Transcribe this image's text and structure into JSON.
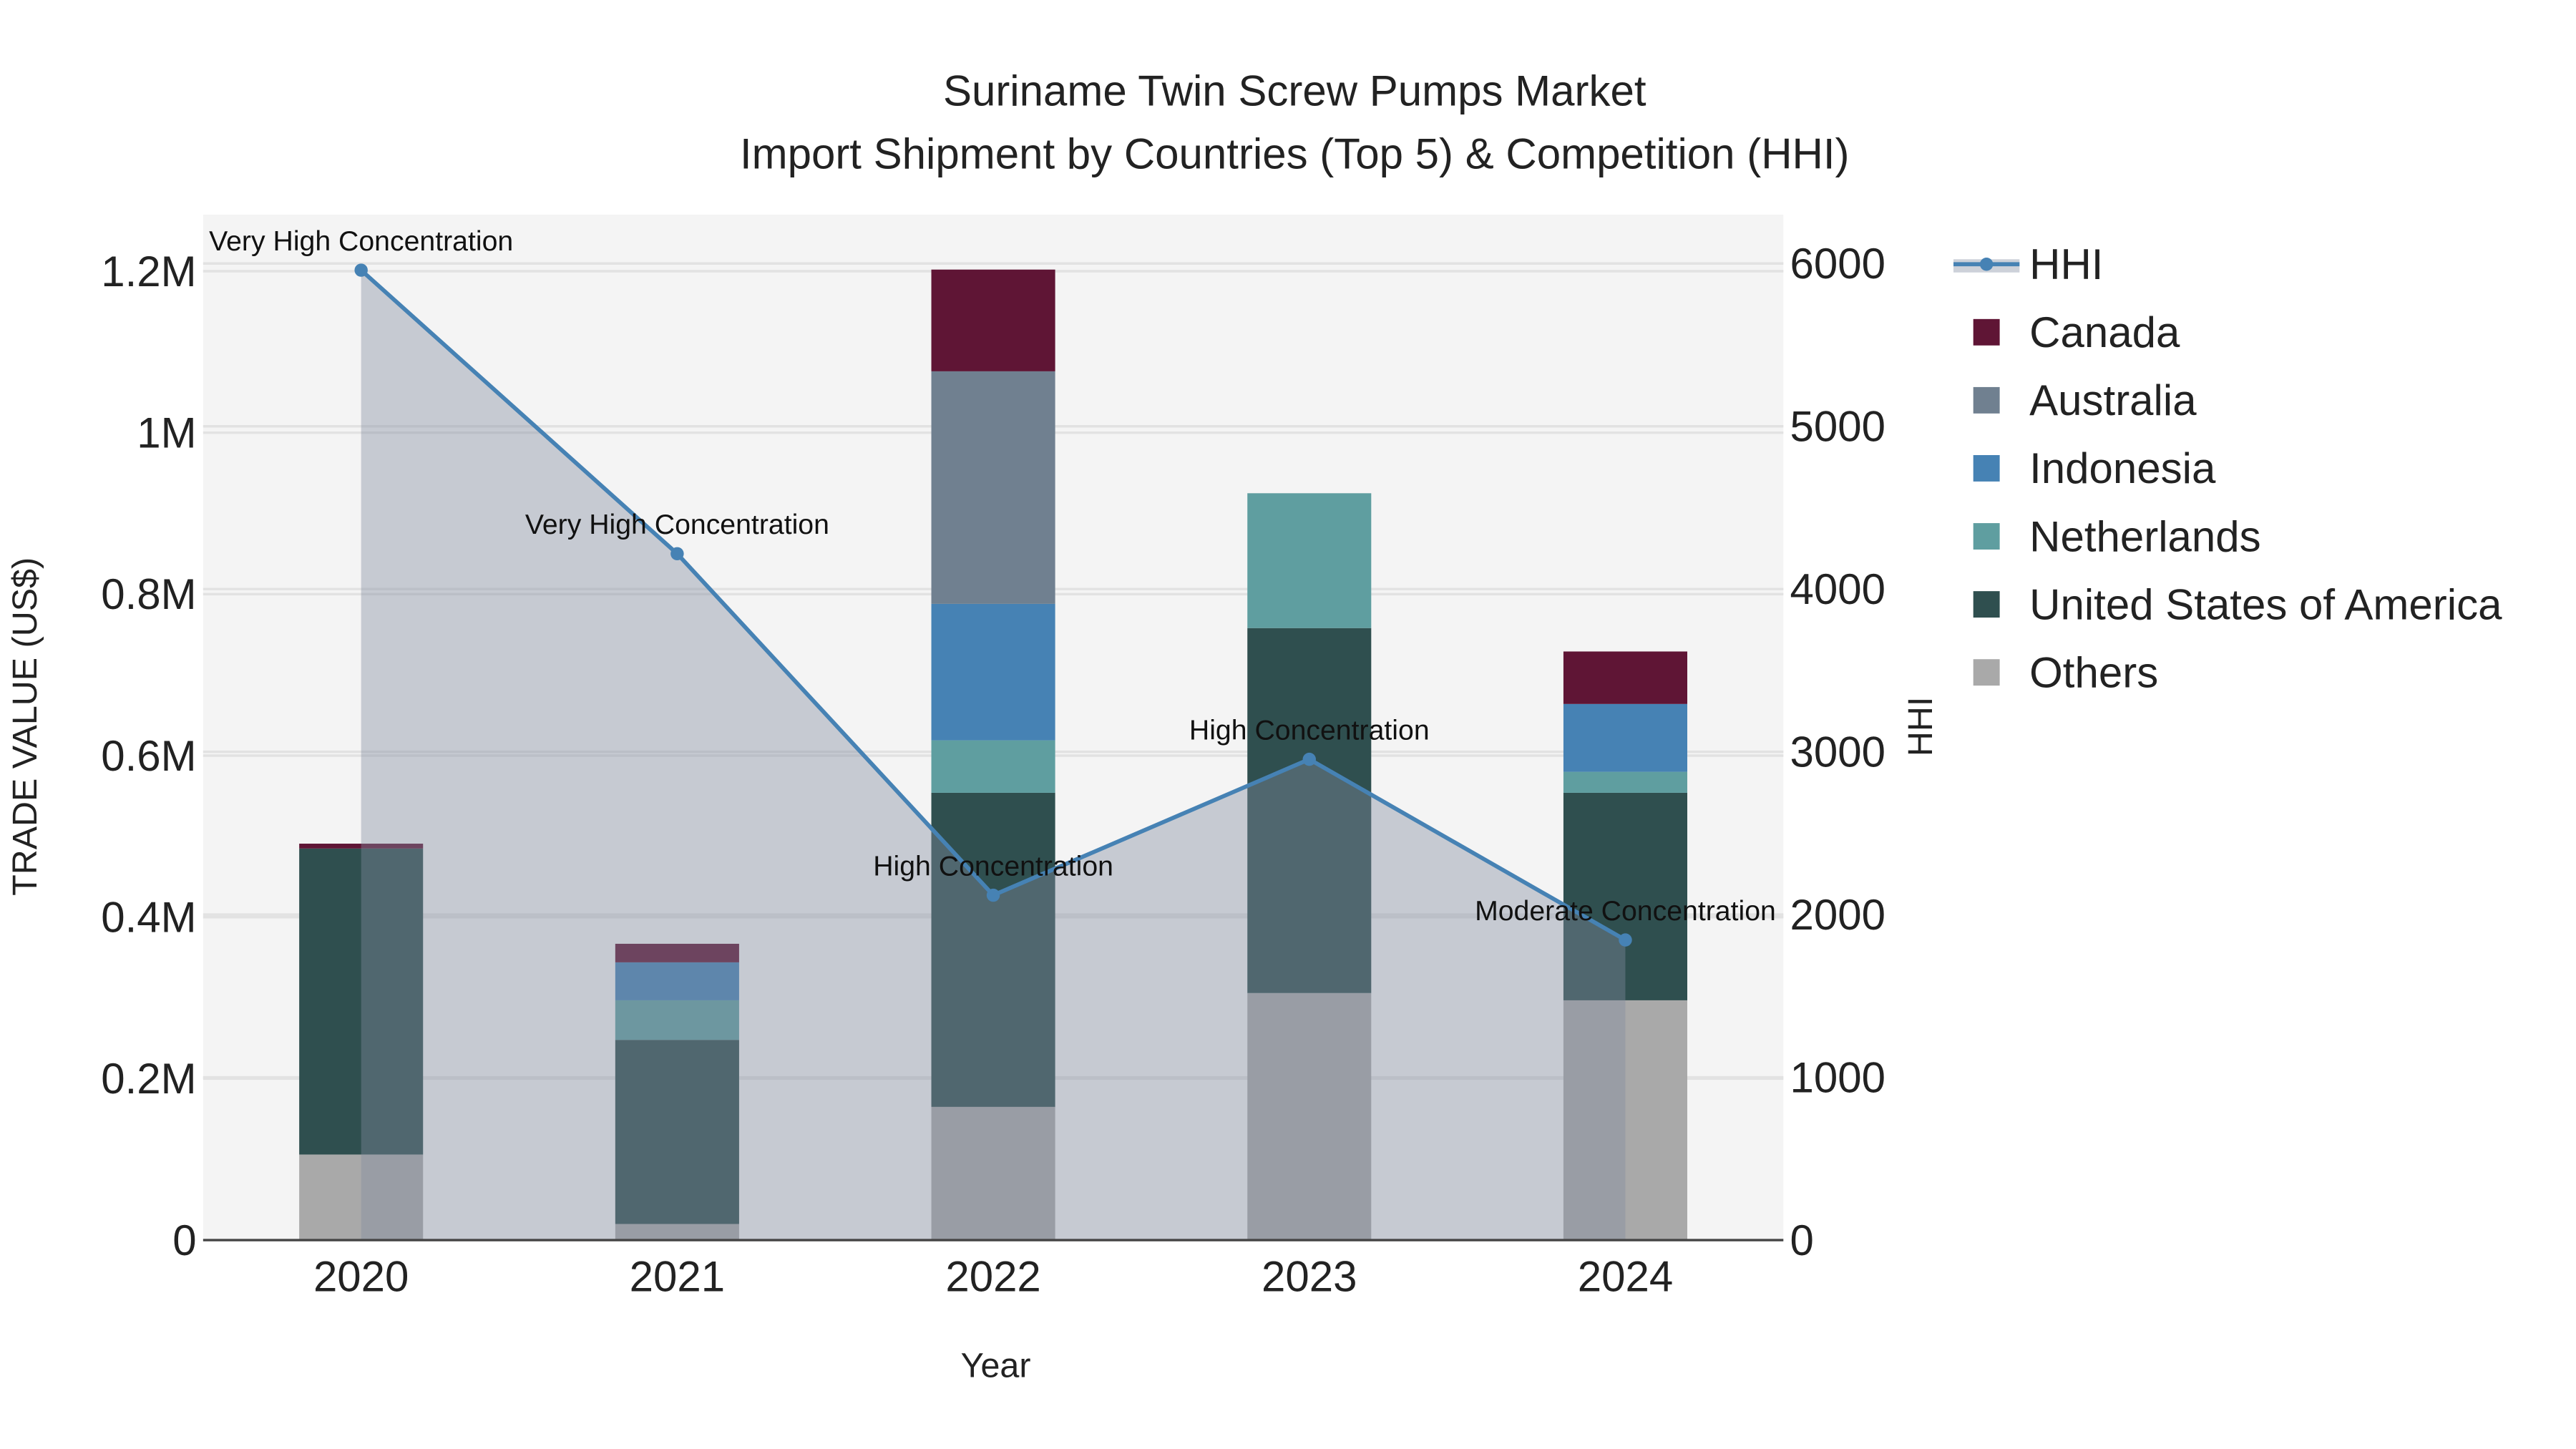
{
  "chart_data": {
    "type": "bar",
    "title": "Suriname Twin Screw Pumps Market",
    "subtitle": "Import Shipment by Countries (Top 5) & Competition (HHI)",
    "xlabel": "Year",
    "ylabel": "TRADE VALUE (US$)",
    "y2label": "HHI",
    "categories": [
      "2020",
      "2021",
      "2022",
      "2023",
      "2024"
    ],
    "ylim": [
      0,
      1.27
    ],
    "y_unit": "M",
    "yticks": [
      0,
      0.2,
      0.4,
      0.6,
      0.8,
      1,
      1.2
    ],
    "ytick_labels": [
      "0",
      "0.2M",
      "0.4M",
      "0.6M",
      "0.8M",
      "1M",
      "1.2M"
    ],
    "y2lim": [
      0,
      6300
    ],
    "y2ticks": [
      0,
      1000,
      2000,
      3000,
      4000,
      5000,
      6000
    ],
    "y2tick_labels": [
      "0",
      "1000",
      "2000",
      "3000",
      "4000",
      "5000",
      "6000"
    ],
    "barmode": "stack",
    "series": [
      {
        "name": "Others",
        "color": "#a9a9a9",
        "values": [
          0.106,
          0.02,
          0.165,
          0.306,
          0.297
        ]
      },
      {
        "name": "United States of America",
        "color": "#2f4f4f",
        "values": [
          0.379,
          0.228,
          0.389,
          0.452,
          0.257
        ]
      },
      {
        "name": "Netherlands",
        "color": "#5f9ea0",
        "values": [
          0,
          0.049,
          0.065,
          0.167,
          0.026
        ]
      },
      {
        "name": "Indonesia",
        "color": "#4682b4",
        "values": [
          0,
          0.047,
          0.169,
          0,
          0.084
        ]
      },
      {
        "name": "Australia",
        "color": "#708090",
        "values": [
          0,
          0,
          0.288,
          0,
          0
        ]
      },
      {
        "name": "Canada",
        "color": "#5f1535",
        "values": [
          0.006,
          0.023,
          0.126,
          0,
          0.065
        ]
      }
    ],
    "hhi": {
      "name": "HHI",
      "color": "#4682b4",
      "values": [
        5959,
        4217,
        2119,
        2954,
        1844
      ],
      "annotations": [
        "Very High Concentration",
        "Very High Concentration",
        "High Concentration",
        "High Concentration",
        "Moderate Concentration"
      ]
    },
    "legend_order": [
      "HHI",
      "Canada",
      "Australia",
      "Indonesia",
      "Netherlands",
      "United States of America",
      "Others"
    ],
    "legend_position": "right",
    "grid": true
  }
}
